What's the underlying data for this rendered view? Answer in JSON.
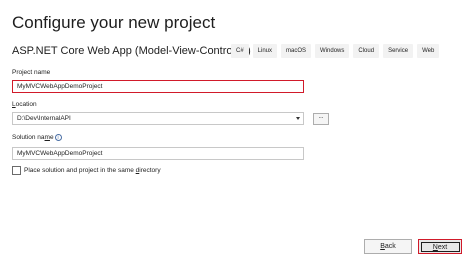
{
  "header": {
    "title": "Configure your new project",
    "template_name": "ASP.NET Core Web App (Model-View-Controller)",
    "tags": [
      "C#",
      "Linux",
      "macOS",
      "Windows",
      "Cloud",
      "Service",
      "Web"
    ]
  },
  "form": {
    "project_name": {
      "label": "Project name",
      "value": "MyMVCWebAppDemoProject"
    },
    "location": {
      "label_mnemonic": "L",
      "label_rest": "ocation",
      "value": "D:\\Dev\\InternalAPI",
      "browse_label": "..."
    },
    "solution_name": {
      "label_start": "Solution na",
      "label_mnemonic": "m",
      "label_end": "e",
      "info_icon": "i",
      "value": "MyMVCWebAppDemoProject"
    },
    "same_directory": {
      "label_start": "Place solution and project in the same ",
      "label_mnemonic": "d",
      "label_end": "irectory",
      "checked": false
    }
  },
  "footer": {
    "back_mnemonic": "B",
    "back_rest": "ack",
    "next_mnemonic": "N",
    "next_rest": "ext"
  },
  "colors": {
    "highlight": "#d11a2a",
    "tag_background": "#f2f2f2"
  }
}
